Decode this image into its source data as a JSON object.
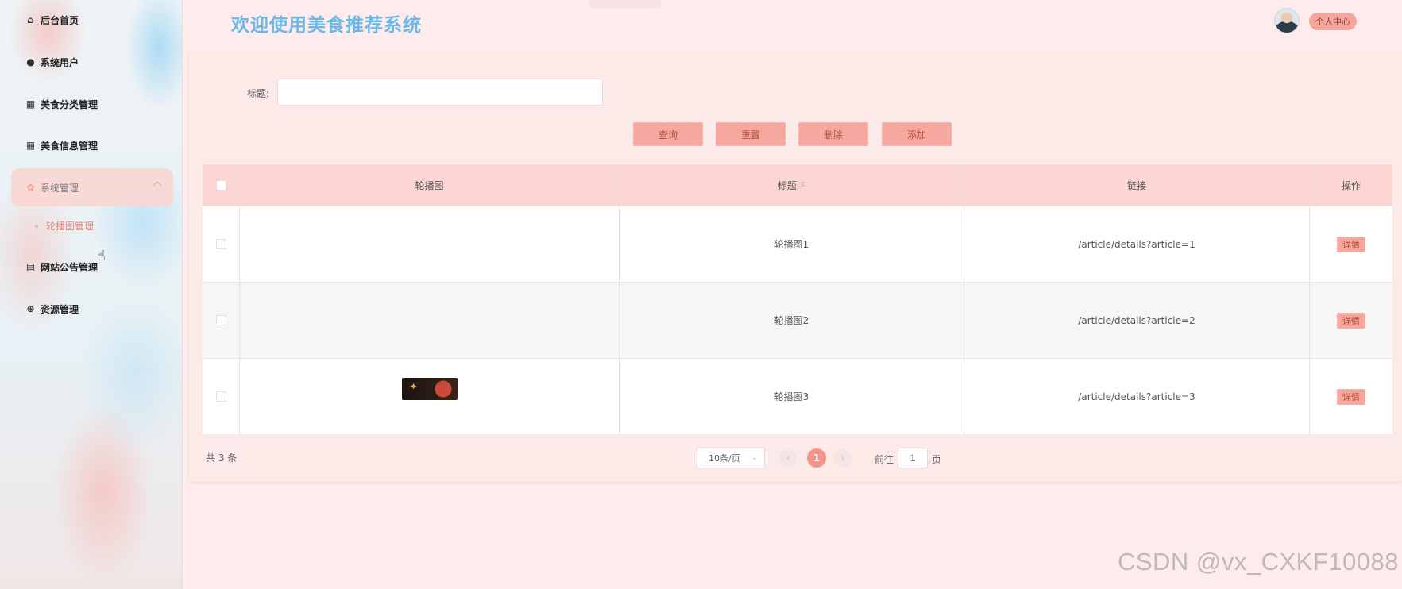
{
  "header": {
    "title": "欢迎使用美食推荐系统",
    "profile_label": "个人中心"
  },
  "sidebar": {
    "items": [
      {
        "label": "后台首页",
        "icon": "home-icon"
      },
      {
        "label": "系统用户",
        "icon": "user-icon"
      },
      {
        "label": "美食分类管理",
        "icon": "grid-icon"
      },
      {
        "label": "美食信息管理",
        "icon": "grid-icon"
      },
      {
        "label": "系统管理",
        "icon": "gear-icon"
      },
      {
        "label": "网站公告管理",
        "icon": "document-icon"
      },
      {
        "label": "资源管理",
        "icon": "plus-circle-icon"
      }
    ],
    "submenu": {
      "label": "轮播图管理"
    }
  },
  "search": {
    "label": "标题:",
    "value": ""
  },
  "toolbar": {
    "query_label": "查询",
    "reset_label": "重置",
    "delete_label": "删除",
    "add_label": "添加"
  },
  "table": {
    "columns": [
      "轮播图",
      "标题",
      "链接",
      "操作"
    ],
    "rows": [
      {
        "title": "轮播图1",
        "link": "/article/details?article=1",
        "action": "详情"
      },
      {
        "title": "轮播图2",
        "link": "/article/details?article=2",
        "action": "详情"
      },
      {
        "title": "轮播图3",
        "link": "/article/details?article=3",
        "action": "详情"
      }
    ]
  },
  "pagination": {
    "total": "共 3 条",
    "page_size": "10条/页",
    "current_page": "1",
    "goto_label": "前往",
    "goto_value": "1",
    "goto_unit": "页"
  },
  "watermark": "CSDN @vx_CXKF10088",
  "colors": {
    "accent": "#f59486",
    "title": "#6bb8ea",
    "header_row": "#fbd5d1"
  }
}
